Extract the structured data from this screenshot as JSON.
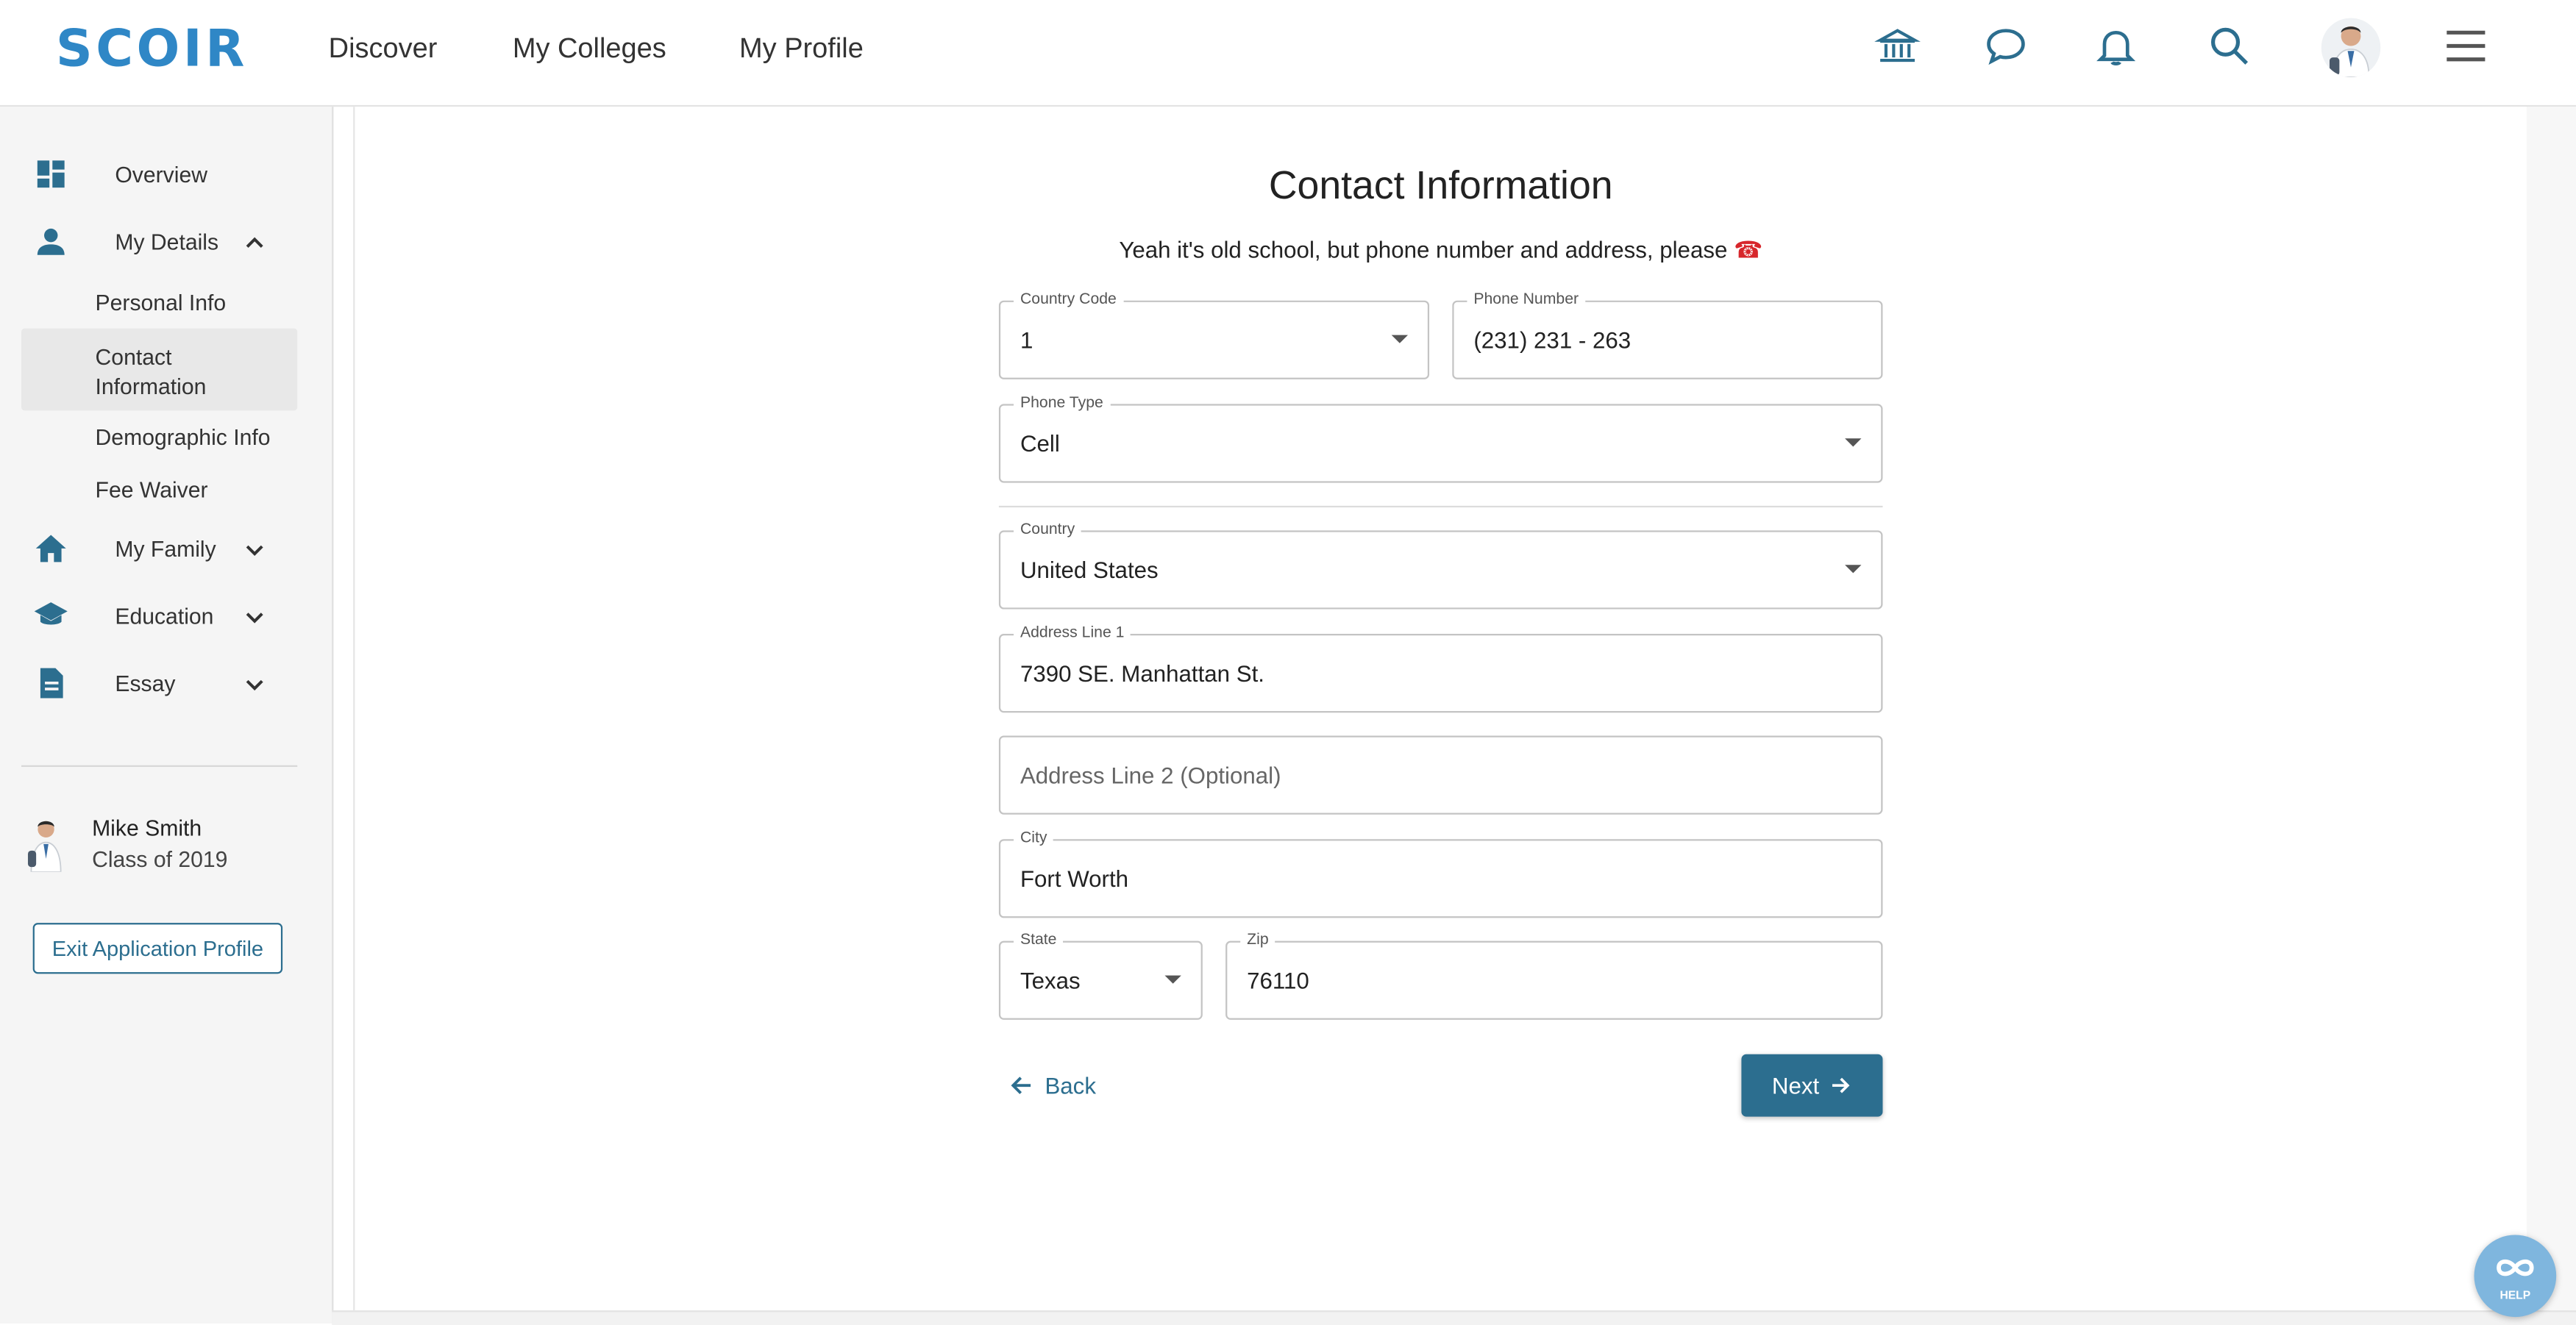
{
  "brand": {
    "logo_text": "SCOIR",
    "accent_color": "#2c6e8f",
    "logo_color": "#2f87c6"
  },
  "topnav": {
    "items": [
      "Discover",
      "My Colleges",
      "My Profile"
    ],
    "icons": [
      "bank-icon",
      "chat-bubble-icon",
      "bell-icon",
      "search-icon",
      "avatar",
      "hamburger-menu-icon"
    ]
  },
  "sidebar": {
    "overview": "Overview",
    "my_details": "My Details",
    "sub_items": [
      "Personal Info",
      "Contact Information",
      "Demographic Info",
      "Fee Waiver"
    ],
    "my_family": "My Family",
    "education": "Education",
    "essay": "Essay",
    "user": {
      "name": "Mike Smith",
      "class": "Class of 2019"
    },
    "exit_button": "Exit Application Profile"
  },
  "main": {
    "title": "Contact Information",
    "subtitle": "Yeah it's old school, but phone number and address, please",
    "subtitle_emoji": "☎",
    "fields": {
      "country_code": {
        "label": "Country Code",
        "value": "1"
      },
      "phone_number": {
        "label": "Phone Number",
        "value": "(231) 231 - 263"
      },
      "phone_type": {
        "label": "Phone Type",
        "value": "Cell"
      },
      "country": {
        "label": "Country",
        "value": "United States"
      },
      "address1": {
        "label": "Address Line 1",
        "value": "7390 SE. Manhattan St."
      },
      "address2": {
        "placeholder": "Address Line 2 (Optional)",
        "value": ""
      },
      "city": {
        "label": "City",
        "value": "Fort Worth"
      },
      "state": {
        "label": "State",
        "value": "Texas"
      },
      "zip": {
        "label": "Zip",
        "value": "76110"
      }
    },
    "back_label": "Back",
    "next_label": "Next"
  },
  "help": {
    "label": "HELP"
  }
}
